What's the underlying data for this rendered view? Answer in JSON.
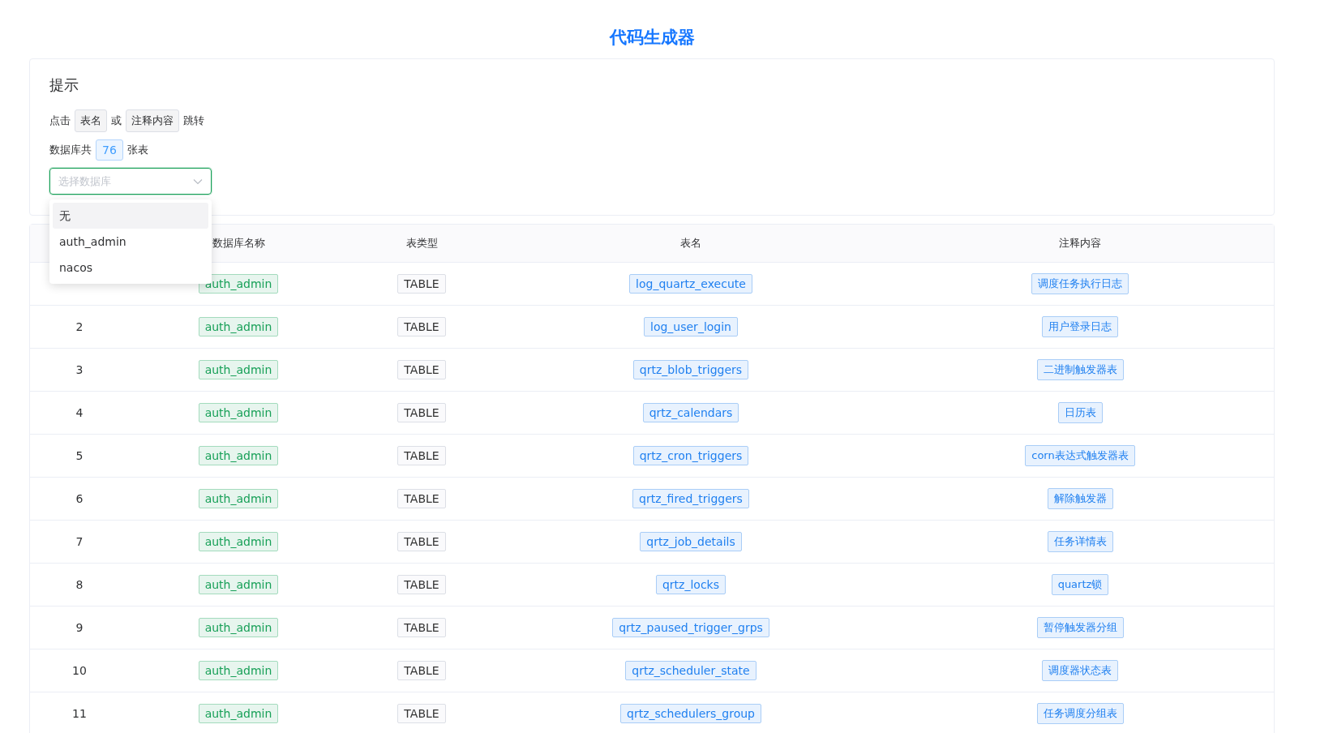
{
  "title": "代码生成器",
  "tips": {
    "heading": "提示",
    "line1": [
      {
        "kind": "text",
        "text": "点击"
      },
      {
        "kind": "tag",
        "text": "表名"
      },
      {
        "kind": "text",
        "text": "或"
      },
      {
        "kind": "tag",
        "text": "注释内容"
      },
      {
        "kind": "text",
        "text": "跳转"
      }
    ],
    "line2": [
      {
        "kind": "text",
        "text": "数据库共"
      },
      {
        "kind": "count",
        "text": "76"
      },
      {
        "kind": "text",
        "text": "张表"
      }
    ]
  },
  "select": {
    "placeholder": "选择数据库",
    "expanded": true,
    "options": [
      {
        "label": "无",
        "highlighted": true
      },
      {
        "label": "auth_admin",
        "highlighted": false
      },
      {
        "label": "nacos",
        "highlighted": false
      }
    ]
  },
  "table": {
    "columns": [
      "数据库名称",
      "表类型",
      "表名",
      "注释内容"
    ],
    "rows": [
      {
        "db": "auth_admin",
        "type": "TABLE",
        "name": "log_quartz_execute",
        "comment": "调度任务执行日志"
      },
      {
        "index": "2",
        "db": "auth_admin",
        "type": "TABLE",
        "name": "log_user_login",
        "comment": "用户登录日志"
      },
      {
        "index": "3",
        "db": "auth_admin",
        "type": "TABLE",
        "name": "qrtz_blob_triggers",
        "comment": "二进制触发器表"
      },
      {
        "index": "4",
        "db": "auth_admin",
        "type": "TABLE",
        "name": "qrtz_calendars",
        "comment": "日历表"
      },
      {
        "index": "5",
        "db": "auth_admin",
        "type": "TABLE",
        "name": "qrtz_cron_triggers",
        "comment": "corn表达式触发器表"
      },
      {
        "index": "6",
        "db": "auth_admin",
        "type": "TABLE",
        "name": "qrtz_fired_triggers",
        "comment": "解除触发器"
      },
      {
        "index": "7",
        "db": "auth_admin",
        "type": "TABLE",
        "name": "qrtz_job_details",
        "comment": "任务详情表"
      },
      {
        "index": "8",
        "db": "auth_admin",
        "type": "TABLE",
        "name": "qrtz_locks",
        "comment": "quartz锁"
      },
      {
        "index": "9",
        "db": "auth_admin",
        "type": "TABLE",
        "name": "qrtz_paused_trigger_grps",
        "comment": "暂停触发器分组"
      },
      {
        "index": "10",
        "db": "auth_admin",
        "type": "TABLE",
        "name": "qrtz_scheduler_state",
        "comment": "调度器状态表"
      },
      {
        "index": "11",
        "db": "auth_admin",
        "type": "TABLE",
        "name": "qrtz_schedulers_group",
        "comment": "任务调度分组表"
      }
    ]
  }
}
